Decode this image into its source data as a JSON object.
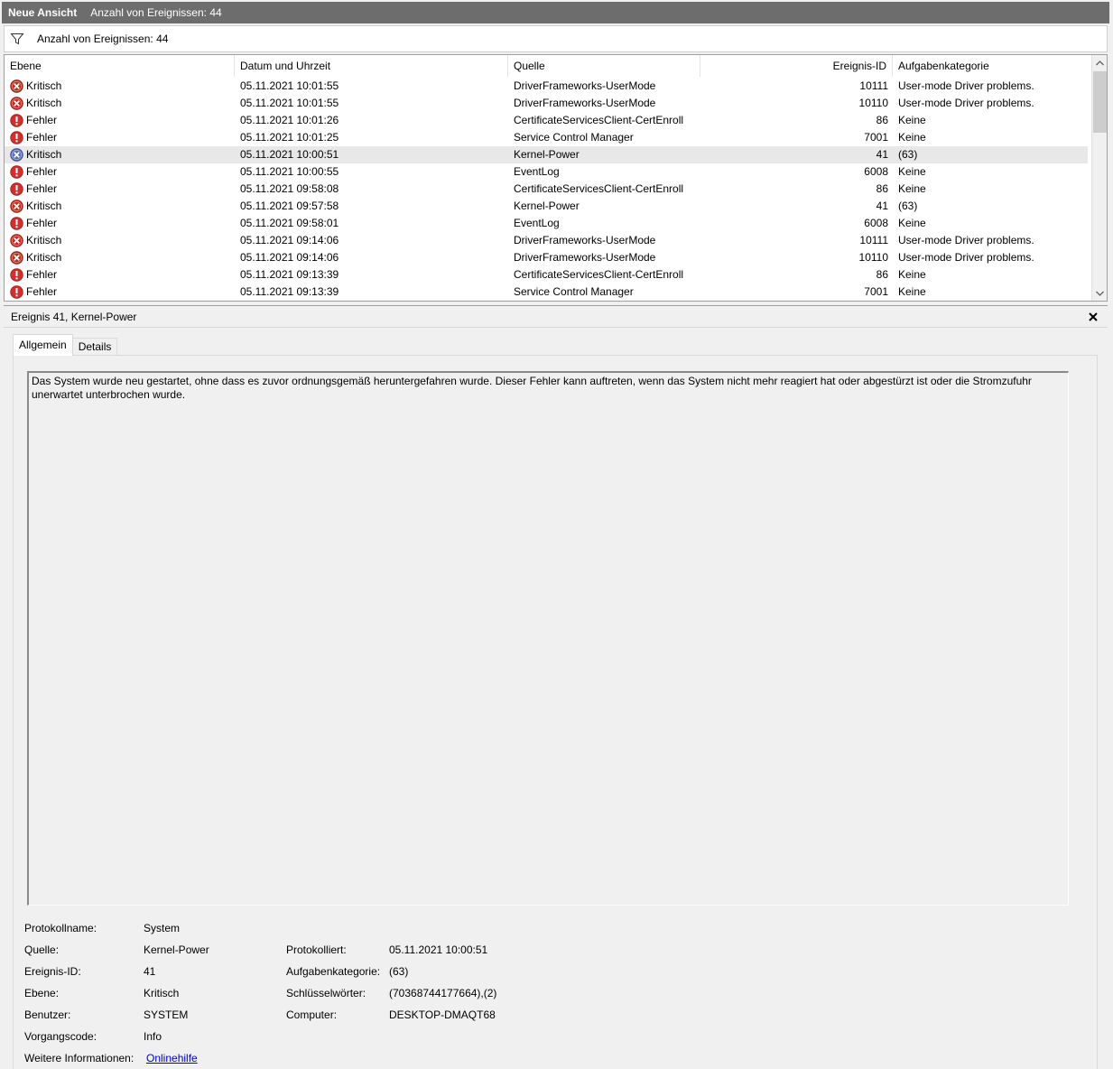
{
  "titlebar": {
    "title": "Neue Ansicht",
    "count": "Anzahl von Ereignissen: 44"
  },
  "filterbar": {
    "text": "Anzahl von Ereignissen: 44",
    "icon": "filter-icon"
  },
  "table": {
    "columns": [
      "Ebene",
      "Datum und Uhrzeit",
      "Quelle",
      "Ereignis-ID",
      "Aufgabenkategorie"
    ],
    "selected_index": 4,
    "rows": [
      {
        "level": "Kritisch",
        "icon": "critical",
        "date": "05.11.2021 10:01:55",
        "source": "DriverFrameworks-UserMode",
        "id": "10111",
        "category": "User-mode Driver problems."
      },
      {
        "level": "Kritisch",
        "icon": "critical",
        "date": "05.11.2021 10:01:55",
        "source": "DriverFrameworks-UserMode",
        "id": "10110",
        "category": "User-mode Driver problems."
      },
      {
        "level": "Fehler",
        "icon": "error",
        "date": "05.11.2021 10:01:26",
        "source": "CertificateServicesClient-CertEnroll",
        "id": "86",
        "category": "Keine"
      },
      {
        "level": "Fehler",
        "icon": "error",
        "date": "05.11.2021 10:01:25",
        "source": "Service Control Manager",
        "id": "7001",
        "category": "Keine"
      },
      {
        "level": "Kritisch",
        "icon": "critical-selected",
        "date": "05.11.2021 10:00:51",
        "source": "Kernel-Power",
        "id": "41",
        "category": "(63)"
      },
      {
        "level": "Fehler",
        "icon": "error",
        "date": "05.11.2021 10:00:55",
        "source": "EventLog",
        "id": "6008",
        "category": "Keine"
      },
      {
        "level": "Fehler",
        "icon": "error",
        "date": "05.11.2021 09:58:08",
        "source": "CertificateServicesClient-CertEnroll",
        "id": "86",
        "category": "Keine"
      },
      {
        "level": "Kritisch",
        "icon": "critical",
        "date": "05.11.2021 09:57:58",
        "source": "Kernel-Power",
        "id": "41",
        "category": "(63)"
      },
      {
        "level": "Fehler",
        "icon": "error",
        "date": "05.11.2021 09:58:01",
        "source": "EventLog",
        "id": "6008",
        "category": "Keine"
      },
      {
        "level": "Kritisch",
        "icon": "critical",
        "date": "05.11.2021 09:14:06",
        "source": "DriverFrameworks-UserMode",
        "id": "10111",
        "category": "User-mode Driver problems."
      },
      {
        "level": "Kritisch",
        "icon": "critical",
        "date": "05.11.2021 09:14:06",
        "source": "DriverFrameworks-UserMode",
        "id": "10110",
        "category": "User-mode Driver problems."
      },
      {
        "level": "Fehler",
        "icon": "error",
        "date": "05.11.2021 09:13:39",
        "source": "CertificateServicesClient-CertEnroll",
        "id": "86",
        "category": "Keine"
      },
      {
        "level": "Fehler",
        "icon": "error",
        "date": "05.11.2021 09:13:39",
        "source": "Service Control Manager",
        "id": "7001",
        "category": "Keine"
      }
    ]
  },
  "detail": {
    "title": "Ereignis 41, Kernel-Power",
    "tabs": [
      "Allgemein",
      "Details"
    ],
    "description": "Das System wurde neu gestartet, ohne dass es zuvor ordnungsgemäß heruntergefahren wurde. Dieser Fehler kann auftreten, wenn das System nicht mehr reagiert hat oder abgestürzt ist oder die Stromzufuhr unerwartet unterbrochen wurde.",
    "props": {
      "protokollname_label": "Protokollname:",
      "protokollname": "System",
      "quelle_label": "Quelle:",
      "quelle": "Kernel-Power",
      "protokolliert_label": "Protokolliert:",
      "protokolliert": "05.11.2021 10:00:51",
      "ereignisid_label": "Ereignis-ID:",
      "ereignisid": "41",
      "aufgabenkategorie_label": "Aufgabenkategorie:",
      "aufgabenkategorie": "(63)",
      "ebene_label": "Ebene:",
      "ebene": "Kritisch",
      "schluesselwoerter_label": "Schlüsselwörter:",
      "schluesselwoerter": "(70368744177664),(2)",
      "benutzer_label": "Benutzer:",
      "benutzer": "SYSTEM",
      "computer_label": "Computer:",
      "computer": "DESKTOP-DMAQT68",
      "vorgangscode_label": "Vorgangscode:",
      "vorgangscode": "Info",
      "weitere_label": "Weitere Informationen:",
      "weitere_link": "Onlinehilfe"
    }
  },
  "colors": {
    "titlebar": "#6d6d6d",
    "critical": "#c42b1c",
    "error": "#d32f2f",
    "link": "#0000cc"
  }
}
